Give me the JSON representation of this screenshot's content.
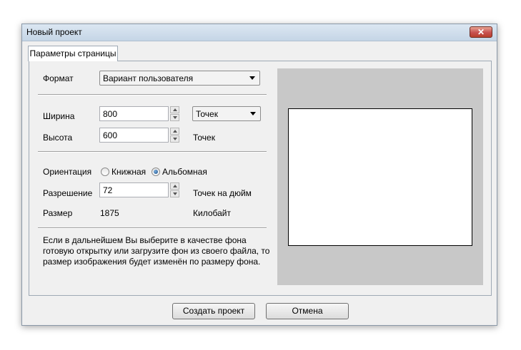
{
  "window": {
    "title": "Новый проект"
  },
  "tabs": [
    {
      "label": "Параметры страницы"
    }
  ],
  "format": {
    "label": "Формат",
    "value": "Вариант пользователя"
  },
  "width": {
    "label": "Ширина",
    "value": "800",
    "unit": "Точек"
  },
  "height": {
    "label": "Высота",
    "value": "600",
    "unit": "Точек"
  },
  "orientation": {
    "label": "Ориентация",
    "options": [
      {
        "label": "Книжная",
        "selected": false
      },
      {
        "label": "Альбомная",
        "selected": true
      }
    ]
  },
  "resolution": {
    "label": "Разрешение",
    "value": "72",
    "unit": "Точек на дюйм"
  },
  "size": {
    "label": "Размер",
    "value": "1875",
    "unit": "Килобайт"
  },
  "note": "Если в дальнейшем Вы выберите в качестве фона готовую открытку или загрузите фон из своего файла, то размер изображения будет изменён по размеру фона.",
  "buttons": {
    "create": "Создать проект",
    "cancel": "Отмена"
  },
  "colors": {
    "preview_bg": "#c8c8c8",
    "close_button": "#c75050"
  }
}
